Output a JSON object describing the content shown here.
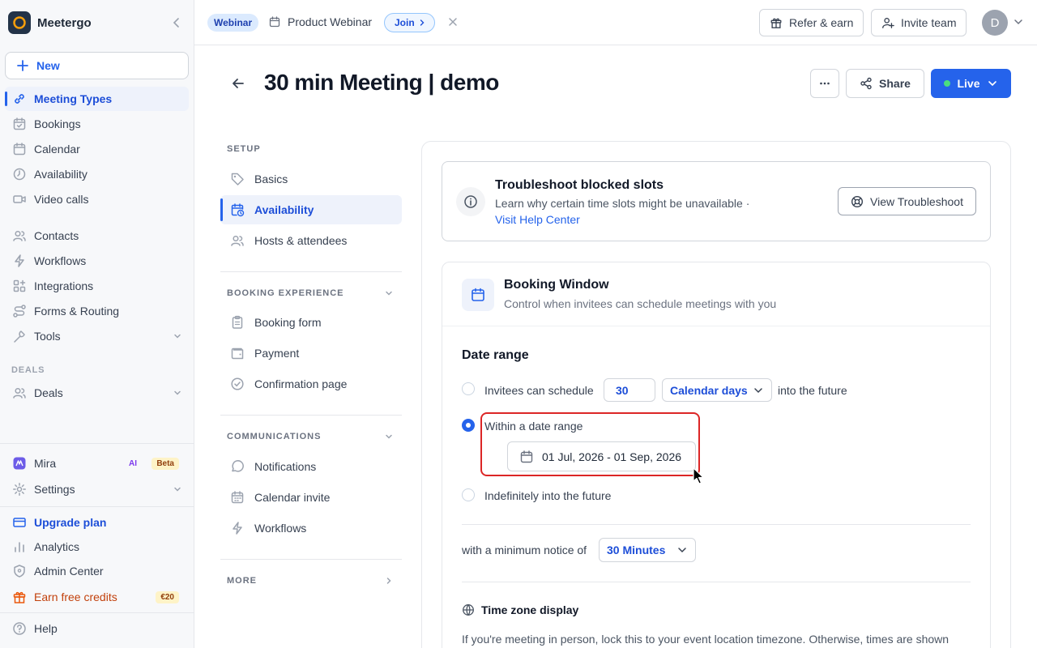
{
  "sidebar": {
    "brand": "Meetergo",
    "new_label": "New",
    "items": [
      {
        "label": "Meeting Types",
        "icon": "link-icon",
        "active": true
      },
      {
        "label": "Bookings",
        "icon": "calendar-check-icon"
      },
      {
        "label": "Calendar",
        "icon": "calendar-icon"
      },
      {
        "label": "Availability",
        "icon": "clock-icon"
      },
      {
        "label": "Video calls",
        "icon": "video-icon"
      },
      {
        "label": "Contacts",
        "icon": "users-icon"
      },
      {
        "label": "Workflows",
        "icon": "bolt-icon"
      },
      {
        "label": "Integrations",
        "icon": "grid-plus-icon"
      },
      {
        "label": "Forms & Routing",
        "icon": "route-icon"
      },
      {
        "label": "Tools",
        "icon": "wrench-icon"
      }
    ],
    "deals_section": "DEALS",
    "deals_label": "Deals",
    "mira_label": "Mira",
    "mira_ai": "AI",
    "mira_beta": "Beta",
    "settings_label": "Settings",
    "upgrade_label": "Upgrade plan",
    "analytics_label": "Analytics",
    "admin_label": "Admin Center",
    "earn_label": "Earn free credits",
    "earn_badge": "€20",
    "help_label": "Help"
  },
  "topbar": {
    "webinar_tag": "Webinar",
    "webinar_title": "Product Webinar",
    "join_label": "Join",
    "refer_label": "Refer & earn",
    "invite_label": "Invite team",
    "avatar_initial": "D"
  },
  "header": {
    "title": "30 min Meeting | demo",
    "share_label": "Share",
    "live_label": "Live"
  },
  "subnav": {
    "setup_section": "SETUP",
    "basics": "Basics",
    "availability": "Availability",
    "hosts": "Hosts & attendees",
    "booking_section": "BOOKING EXPERIENCE",
    "booking_form": "Booking form",
    "payment": "Payment",
    "confirmation": "Confirmation page",
    "comms_section": "COMMUNICATIONS",
    "notifications": "Notifications",
    "calendar_invite": "Calendar invite",
    "workflows": "Workflows",
    "more_section": "MORE"
  },
  "troubleshoot": {
    "title": "Troubleshoot blocked slots",
    "desc": "Learn why certain time slots might be unavailable ·",
    "link": "Visit Help Center",
    "button": "View Troubleshoot"
  },
  "booking_window": {
    "title": "Booking Window",
    "desc": "Control when invitees can schedule meetings with you",
    "date_range_title": "Date range",
    "opt1_prefix": "Invitees can schedule",
    "opt1_value": "30",
    "opt1_unit": "Calendar days",
    "opt1_suffix": "into the future",
    "opt2_label": "Within a date range",
    "opt2_value": "01 Jul, 2026 - 01 Sep, 2026",
    "opt3_label": "Indefinitely into the future",
    "selected_option": 2,
    "notice_label": "with a minimum notice of",
    "notice_value": "30 Minutes",
    "tz_title": "Time zone display",
    "tz_desc": "If you're meeting in person, lock this to your event location timezone. Otherwise, times are shown"
  },
  "colors": {
    "accent": "#2563eb",
    "highlight": "#dc2626",
    "live_dot": "#4ade80"
  }
}
